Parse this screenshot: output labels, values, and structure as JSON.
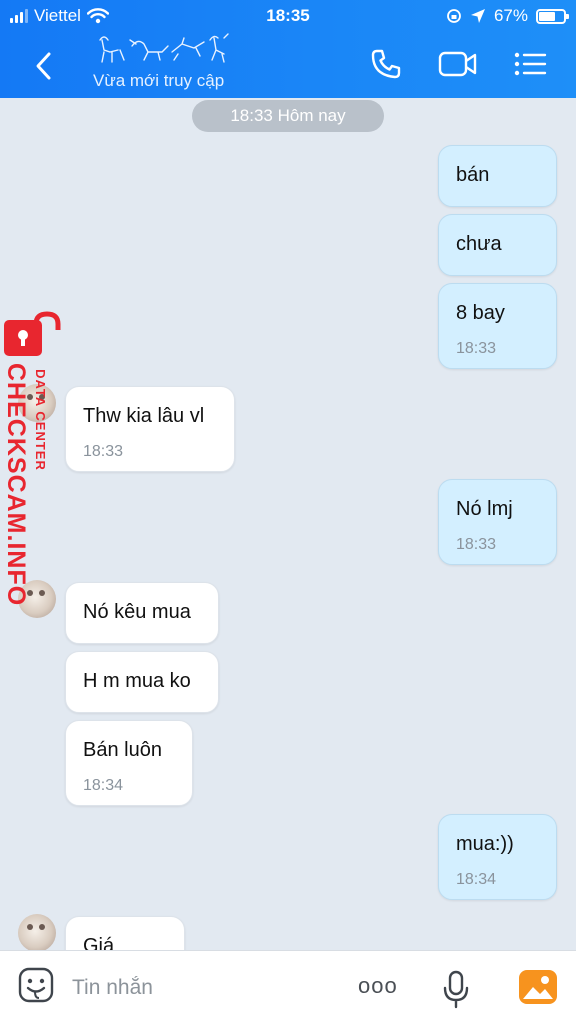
{
  "status_bar": {
    "carrier": "Viettel",
    "time": "18:35",
    "battery": "67%",
    "battery_level": 0.67
  },
  "header": {
    "contact_status": "Vừa mới truy cập",
    "icons": [
      "back-icon",
      "phone-icon",
      "video-call-icon",
      "menu-list-icon"
    ]
  },
  "chat": {
    "date_label": "18:33 Hôm nay",
    "messages": [
      {
        "dir": "out",
        "text": "bán",
        "time": ""
      },
      {
        "dir": "out",
        "text": "chưa",
        "time": ""
      },
      {
        "dir": "out",
        "text": "8 bay",
        "time": "18:33"
      },
      {
        "dir": "in",
        "text": "Thw kia lâu vl",
        "time": "18:33"
      },
      {
        "dir": "out",
        "text": "Nó lmj",
        "time": "18:33"
      },
      {
        "dir": "in",
        "text": "Nó kêu mua",
        "time": ""
      },
      {
        "dir": "in",
        "text": "H m mua ko",
        "time": ""
      },
      {
        "dir": "in",
        "text": "Bán luôn",
        "time": "18:34"
      },
      {
        "dir": "out",
        "text": "mua:))",
        "time": "18:34"
      },
      {
        "dir": "in",
        "text": "Giá",
        "time": ""
      }
    ]
  },
  "watermark": {
    "main": "CHECKSCAM.INFO",
    "sub": "DATA CENTER"
  },
  "composer": {
    "placeholder": "Tin nhắn",
    "more_label": "ooo"
  },
  "colors": {
    "header": "#1a86f7",
    "outgoing_bubble": "#d3efff",
    "incoming_bubble": "#ffffff",
    "chat_bg": "#e2e9f1",
    "watermark": "#e8262f"
  }
}
